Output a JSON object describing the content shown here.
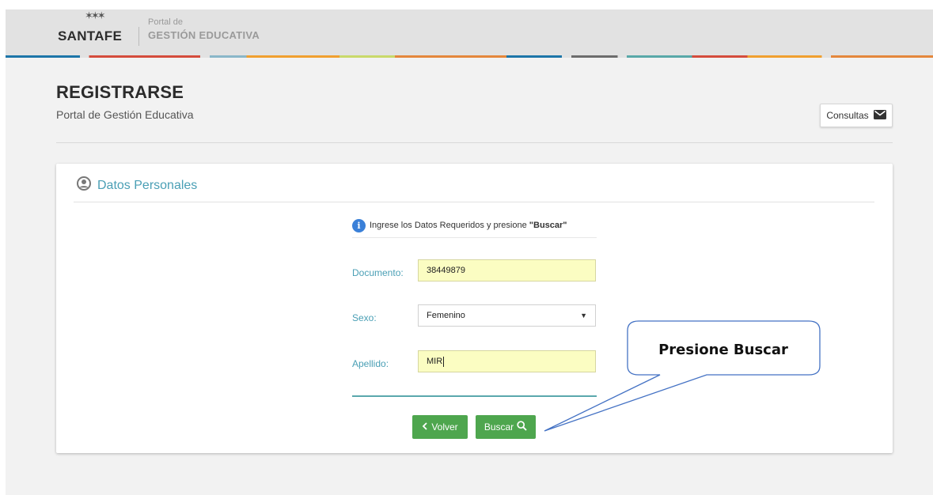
{
  "header": {
    "logo_stars": "✶✶✶",
    "logo_brand": "SANTAFE",
    "portal_label": "Portal de",
    "portal_name": "GESTIÓN EDUCATIVA"
  },
  "page": {
    "title": "REGISTRARSE",
    "subtitle": "Portal de Gestión Educativa",
    "consultas_label": "Consultas"
  },
  "panel": {
    "title": "Datos Personales",
    "info_text": "Ingrese los Datos Requeridos y presione ",
    "info_bold": "\"Buscar\"",
    "fields": {
      "documento_label": "Documento:",
      "documento_value": "38449879",
      "sexo_label": "Sexo:",
      "sexo_value": "Femenino",
      "apellido_label": "Apellido:",
      "apellido_value": "MIR"
    },
    "volver_label": "Volver",
    "buscar_label": "Buscar"
  },
  "callout": {
    "text": "Presione Buscar"
  },
  "colors": {
    "accent": "#4a9fb5",
    "button_green": "#4ea64e",
    "autofill_yellow": "#fbfdc2",
    "info_blue": "#3a80d8"
  },
  "icons": {
    "user": "user-circle-icon",
    "envelope": "envelope-icon",
    "info": "info-icon",
    "chevron_left": "chevron-left-icon",
    "search": "search-icon",
    "dropdown": "caret-down-icon"
  }
}
